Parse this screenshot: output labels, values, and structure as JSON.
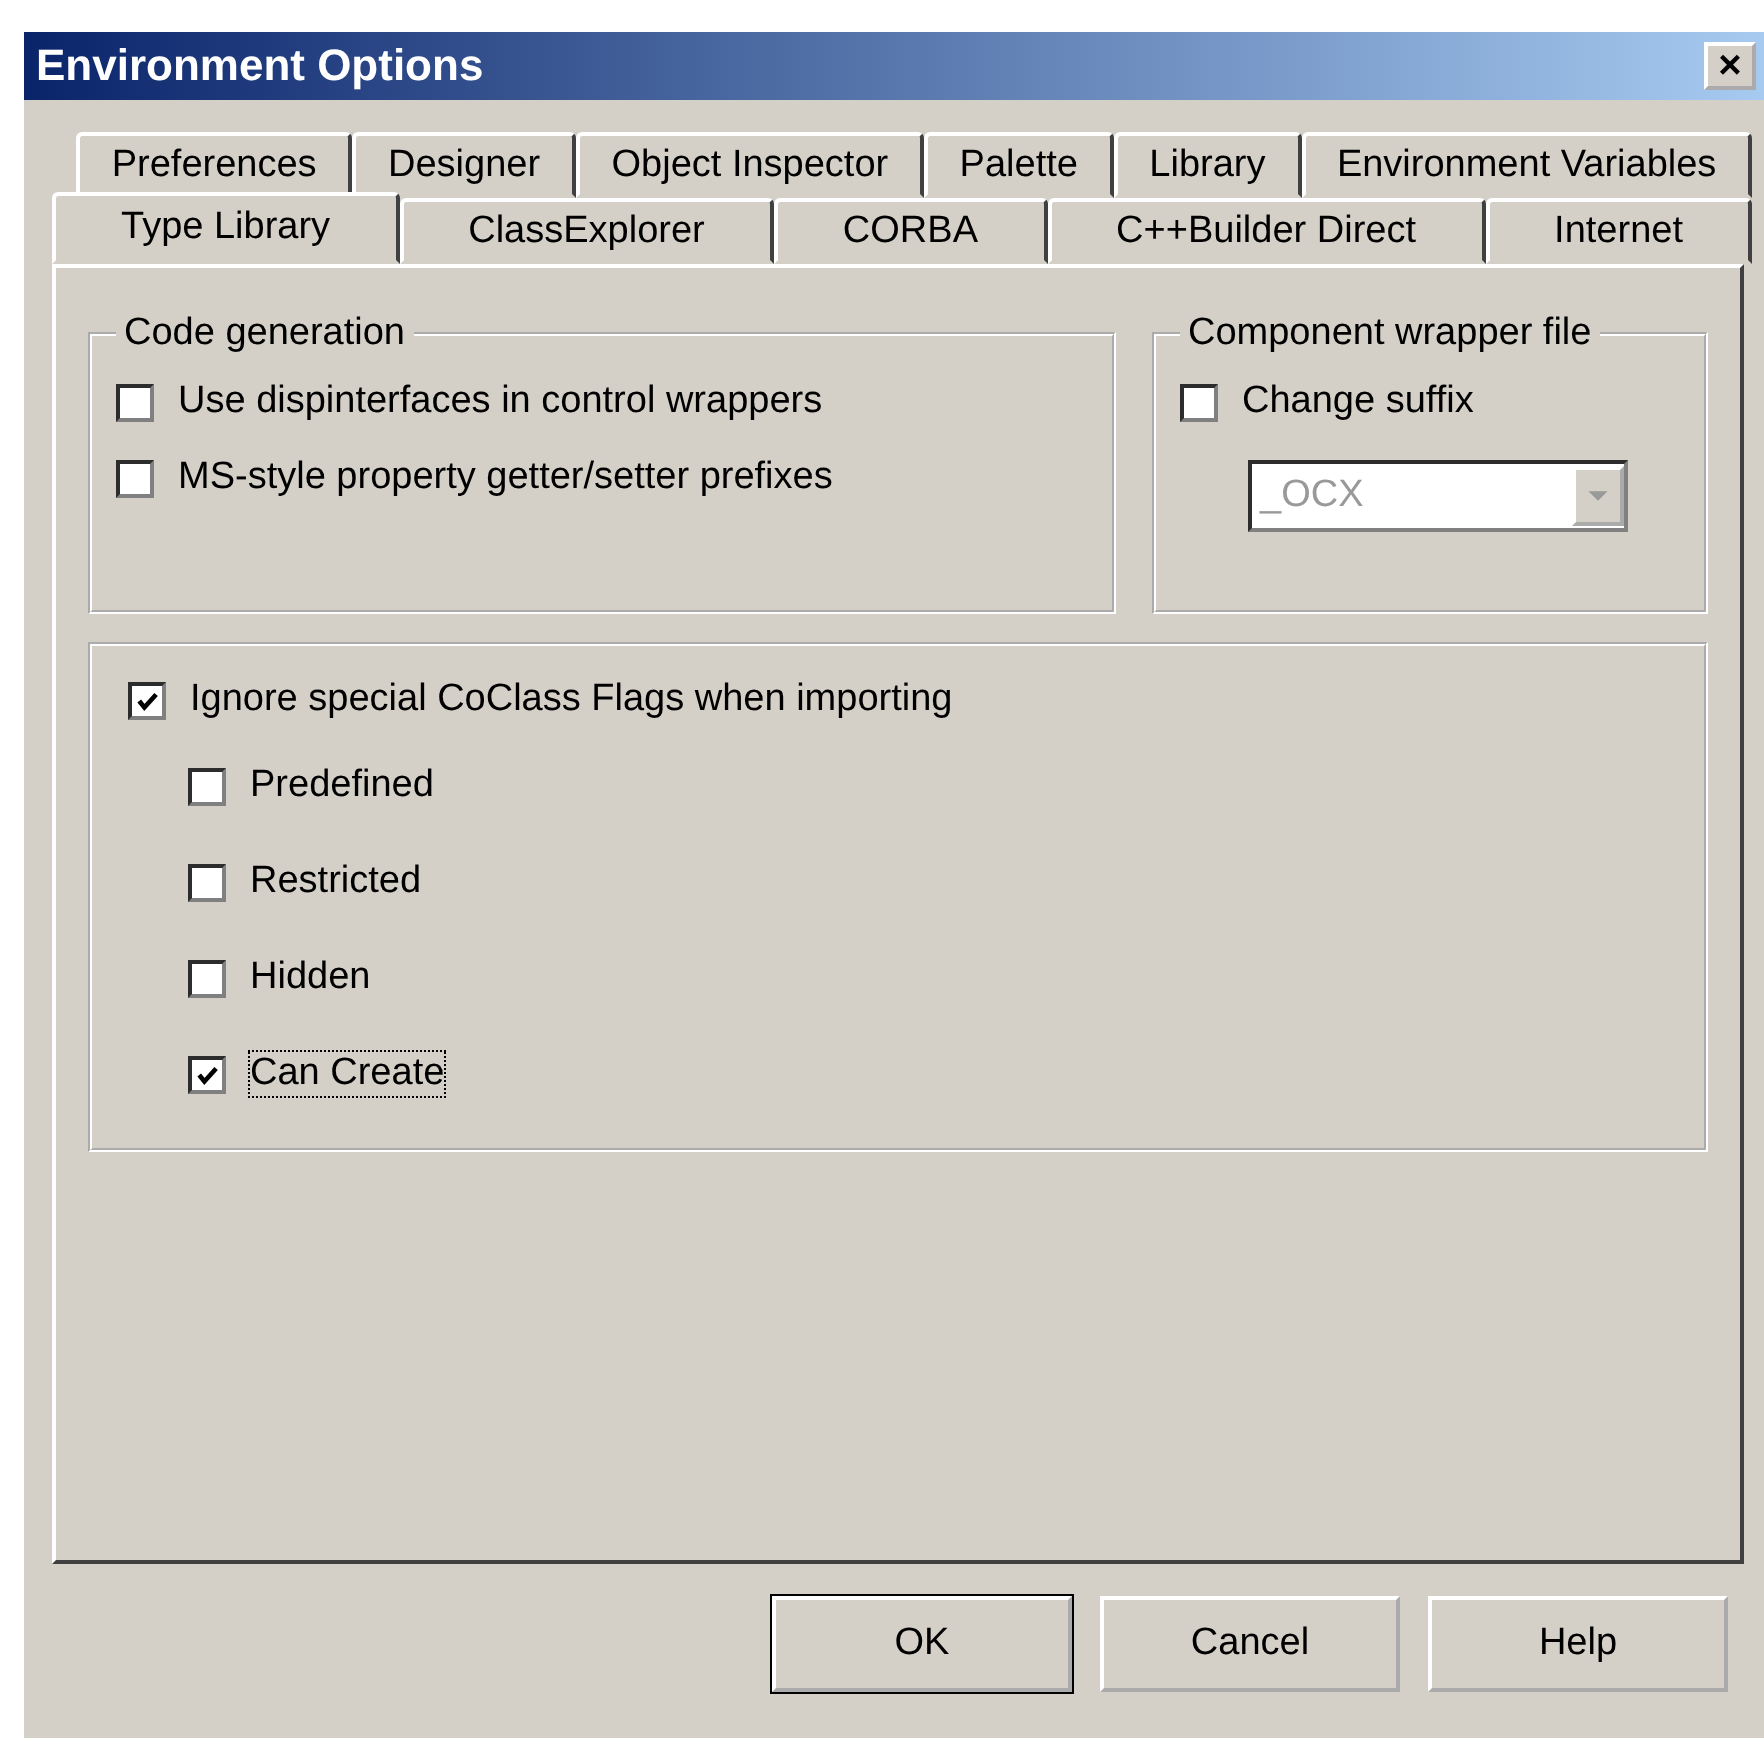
{
  "window": {
    "title": "Environment Options",
    "close": "×"
  },
  "tab_rows": [
    {
      "tabs": [
        {
          "label": "Preferences",
          "selected": false
        },
        {
          "label": "Designer",
          "selected": false
        },
        {
          "label": "Object Inspector",
          "selected": false
        },
        {
          "label": "Palette",
          "selected": false
        },
        {
          "label": "Library",
          "selected": false
        },
        {
          "label": "Environment Variables",
          "selected": false
        }
      ]
    },
    {
      "tabs": [
        {
          "label": "Type Library",
          "selected": true
        },
        {
          "label": "ClassExplorer",
          "selected": false
        },
        {
          "label": "CORBA",
          "selected": false
        },
        {
          "label": "C++Builder Direct",
          "selected": false
        },
        {
          "label": "Internet",
          "selected": false
        }
      ]
    }
  ],
  "code_generation": {
    "title": "Code generation",
    "options": [
      {
        "label": "Use dispinterfaces in control wrappers",
        "checked": false
      },
      {
        "label": "MS-style property getter/setter prefixes",
        "checked": false
      }
    ]
  },
  "component_wrapper_file": {
    "title": "Component wrapper file",
    "option": {
      "label": "Change suffix",
      "checked": false
    },
    "suffix": {
      "value": "_OCX",
      "disabled": true
    }
  },
  "import_flags": {
    "label": "Ignore special CoClass Flags when importing",
    "checked": true,
    "children": [
      {
        "label": "Predefined",
        "checked": false,
        "focused": false
      },
      {
        "label": "Restricted",
        "checked": false,
        "focused": false
      },
      {
        "label": "Hidden",
        "checked": false,
        "focused": false
      },
      {
        "label": "Can Create",
        "checked": true,
        "focused": true
      }
    ]
  },
  "buttons": [
    {
      "label": "OK",
      "default": true
    },
    {
      "label": "Cancel",
      "default": false
    },
    {
      "label": "Help",
      "default": false
    }
  ]
}
